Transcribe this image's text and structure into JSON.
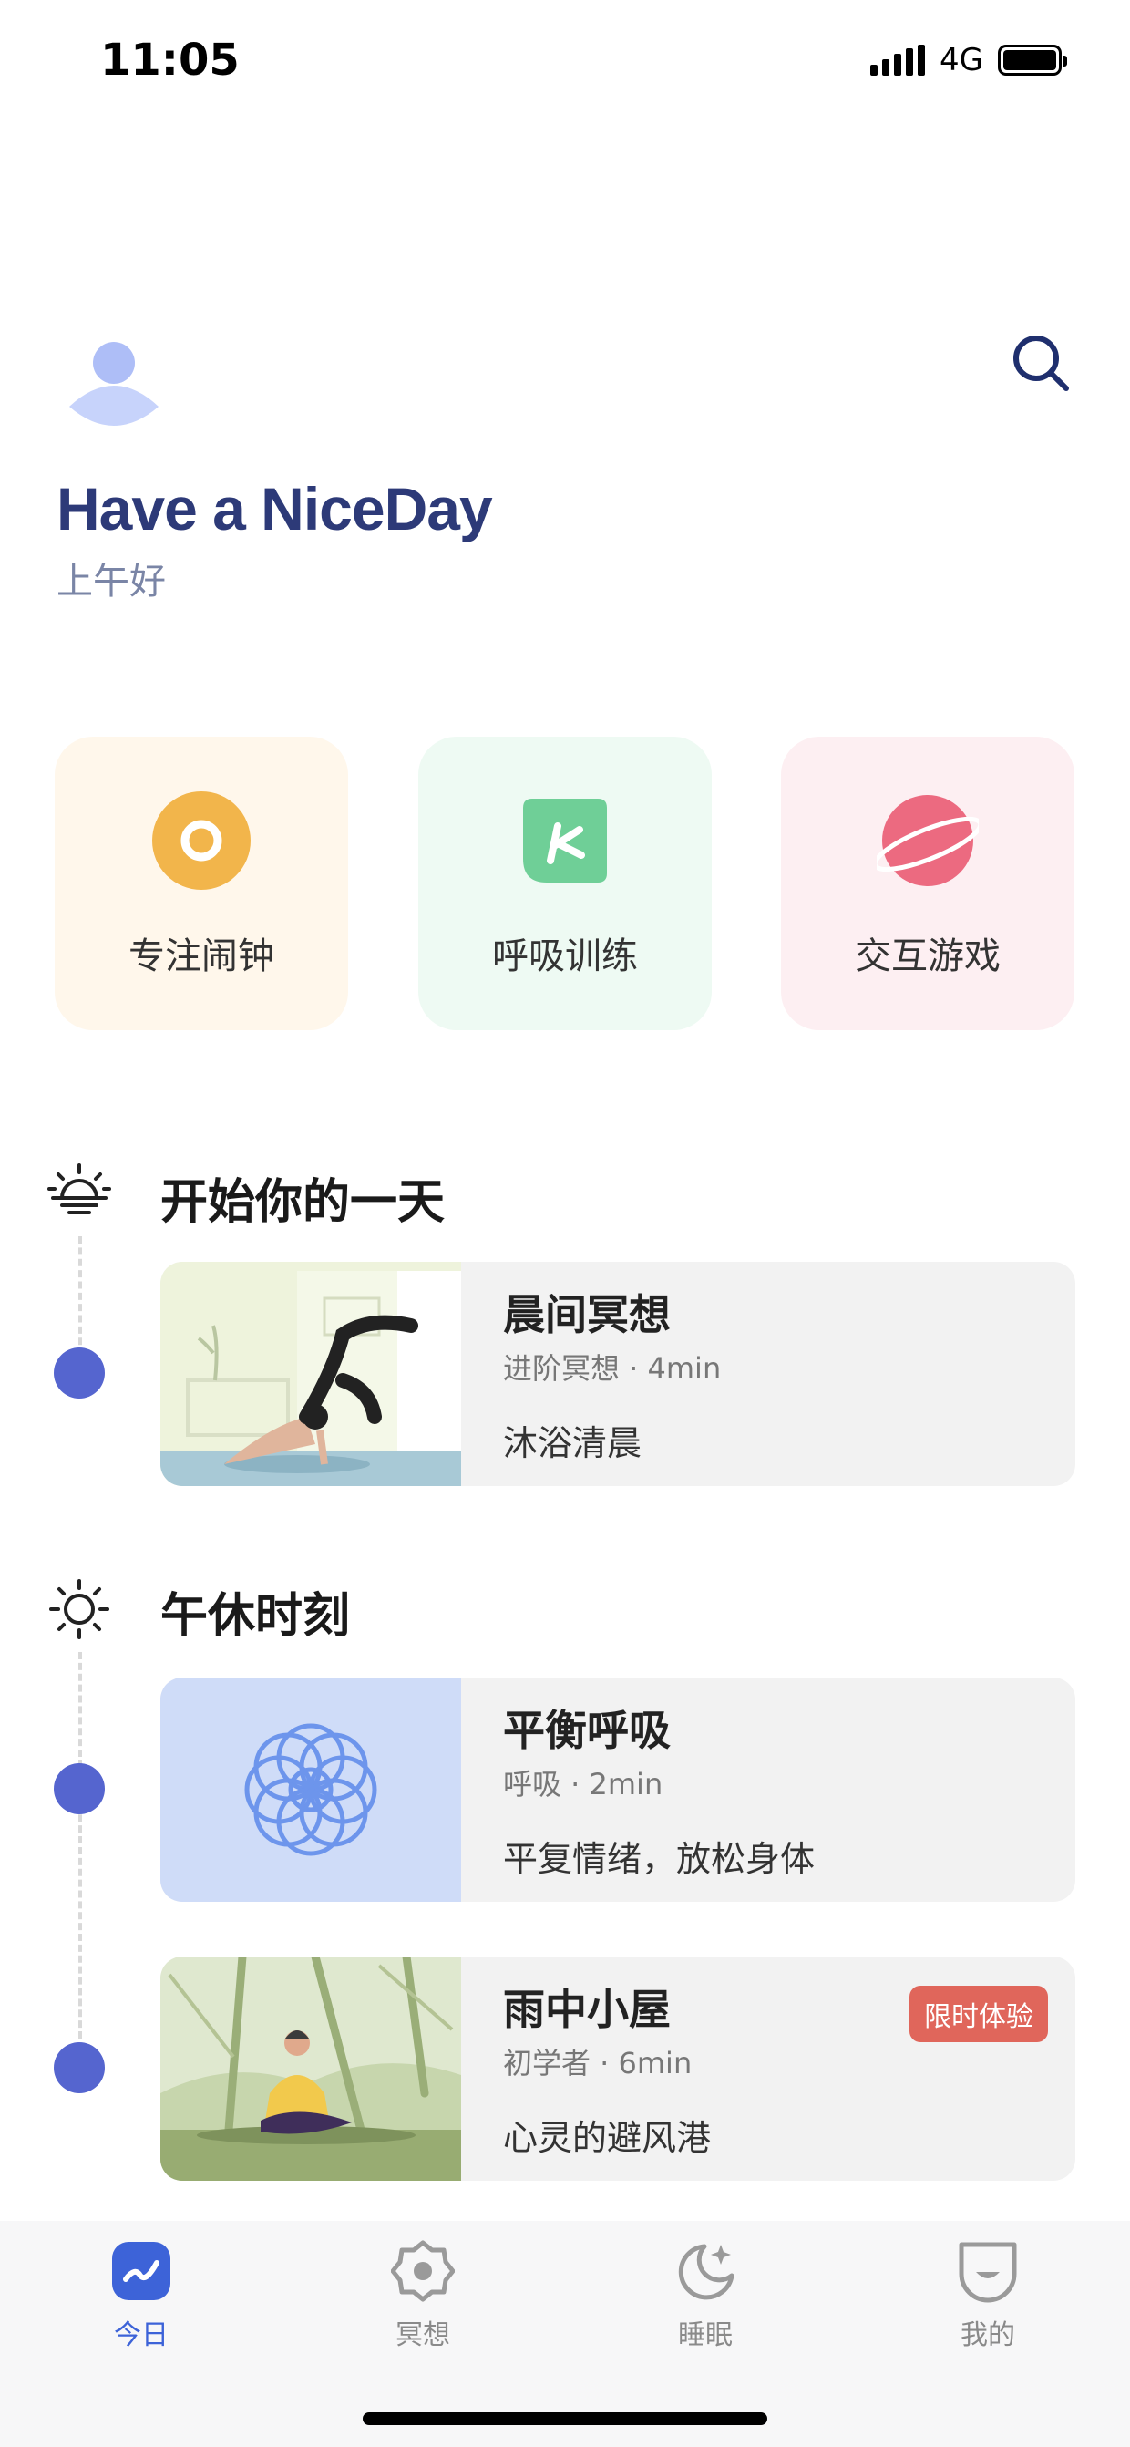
{
  "status_bar": {
    "time": "11:05",
    "network": "4G"
  },
  "header": {
    "title": "Have a NiceDay",
    "greeting": "上午好"
  },
  "quick_actions": [
    {
      "label": "专注闹钟",
      "icon": "alarm-ring-icon",
      "bg": "#fff7eb",
      "color": "#f2b54b"
    },
    {
      "label": "呼吸训练",
      "icon": "leaf-icon",
      "bg": "#eefaf3",
      "color": "#6fcf97"
    },
    {
      "label": "交互游戏",
      "icon": "planet-icon",
      "bg": "#fdeff2",
      "color": "#ec6a80"
    }
  ],
  "sections": [
    {
      "title": "开始你的一天",
      "icon": "sunrise-icon",
      "items": [
        {
          "title": "晨间冥想",
          "meta": "进阶冥想 · 4min",
          "desc": "沐浴清晨",
          "thumb": "yoga-illustration"
        }
      ]
    },
    {
      "title": "午休时刻",
      "icon": "sun-icon",
      "items": [
        {
          "title": "平衡呼吸",
          "meta": "呼吸 · 2min",
          "desc": "平复情绪，放松身体",
          "thumb": "flower-illustration"
        },
        {
          "title": "雨中小屋",
          "meta": "初学者 · 6min",
          "desc": "心灵的避风港",
          "badge": "限时体验",
          "thumb": "forest-meditation-illustration"
        }
      ]
    }
  ],
  "tabbar": {
    "tabs": [
      {
        "label": "今日",
        "icon": "today-icon",
        "active": true
      },
      {
        "label": "冥想",
        "icon": "meditation-icon",
        "active": false
      },
      {
        "label": "睡眠",
        "icon": "moon-icon",
        "active": false
      },
      {
        "label": "我的",
        "icon": "profile-icon",
        "active": false
      }
    ]
  },
  "colors": {
    "accent": "#5565cf",
    "title": "#2d3a78",
    "badge": "#e0665b",
    "tab_active": "#3d63d8"
  }
}
